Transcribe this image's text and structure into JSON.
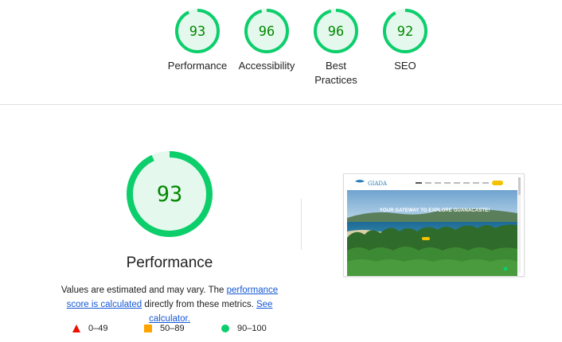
{
  "categories": [
    {
      "score": "93",
      "label": "Performance"
    },
    {
      "score": "96",
      "label": "Accessibility"
    },
    {
      "score": "96",
      "label": "Best Practices"
    },
    {
      "score": "92",
      "label": "SEO"
    }
  ],
  "performance": {
    "score": "93",
    "title": "Performance",
    "desc_prefix": "Values are estimated and may vary. The ",
    "score_link": "performance score is calculated",
    "desc_middle": " directly from these metrics. ",
    "calc_link": "See calculator."
  },
  "legend": [
    {
      "range": "0–49",
      "color": "#eb0f00"
    },
    {
      "range": "50–89",
      "color": "#ffa400"
    },
    {
      "range": "90–100",
      "color": "#0cce6b"
    }
  ],
  "preview": {
    "logo": "GIADA",
    "tagline": "YOUR GATEWAY TO EXPLORE GUANACASTE!"
  },
  "colors": {
    "pass": "#0cce6b",
    "pass_text": "#008800",
    "pass_bg": "#e5f8ee"
  }
}
